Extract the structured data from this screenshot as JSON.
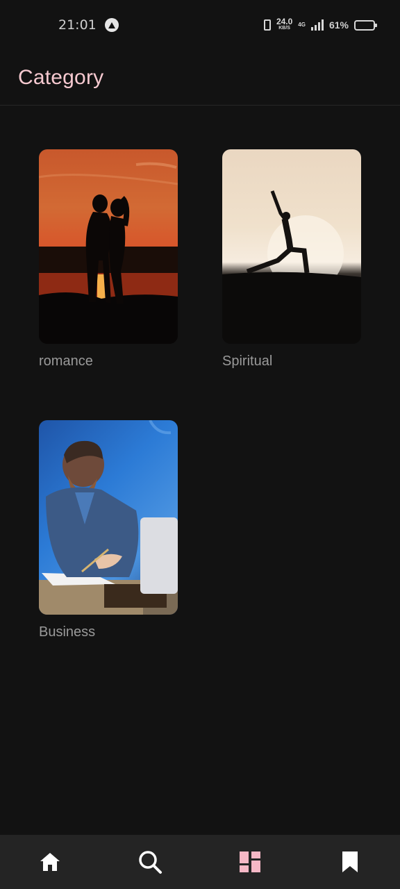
{
  "status_bar": {
    "time": "21:01",
    "speed_value": "24.0",
    "speed_unit": "KB/S",
    "network_label": "4G",
    "battery_percent": "61%",
    "battery_level": 0.61,
    "icons": [
      "notification-icon",
      "vibrate-icon",
      "signal-icon",
      "battery-icon"
    ]
  },
  "header": {
    "title": "Category"
  },
  "categories": [
    {
      "label": "romance",
      "image": "couple-sunset-silhouette"
    },
    {
      "label": "Spiritual",
      "image": "yoga-pose-silhouette"
    },
    {
      "label": "Business",
      "image": "businessman-writing-at-laptop"
    }
  ],
  "bottom_nav": {
    "items": [
      {
        "name": "home",
        "icon": "home-icon",
        "active": false
      },
      {
        "name": "search",
        "icon": "search-icon",
        "active": false
      },
      {
        "name": "category",
        "icon": "grid-icon",
        "active": true
      },
      {
        "name": "bookmarks",
        "icon": "bookmark-icon",
        "active": false
      }
    ]
  },
  "colors": {
    "background": "#121212",
    "accent": "#f6c9d0",
    "nav_background": "#242424",
    "label_text": "#9a9a9a"
  }
}
